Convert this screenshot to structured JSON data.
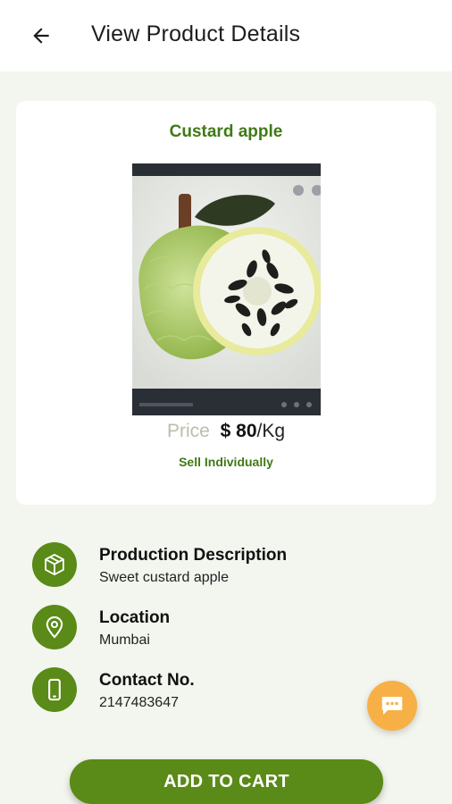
{
  "header": {
    "title": "View Product Details",
    "back_icon": "arrow-left-icon"
  },
  "product": {
    "name": "Custard apple",
    "price_label": "Price",
    "price_value": "$ 80",
    "price_unit": "/Kg",
    "sell_mode": "Sell Individually"
  },
  "details": [
    {
      "icon": "box-icon",
      "title": "Production Description",
      "value": "Sweet custard apple"
    },
    {
      "icon": "location-pin-icon",
      "title": "Location",
      "value": "Mumbai"
    },
    {
      "icon": "phone-icon",
      "title": "Contact No.",
      "value": "2147483647"
    }
  ],
  "chat_fab": {
    "icon": "chat-icon"
  },
  "actions": {
    "add_to_cart_label": "ADD TO CART"
  },
  "colors": {
    "primary_green": "#5a8a17",
    "title_green": "#3f7a16",
    "fab_orange": "#f7b046",
    "background": "#f3f6ee"
  }
}
